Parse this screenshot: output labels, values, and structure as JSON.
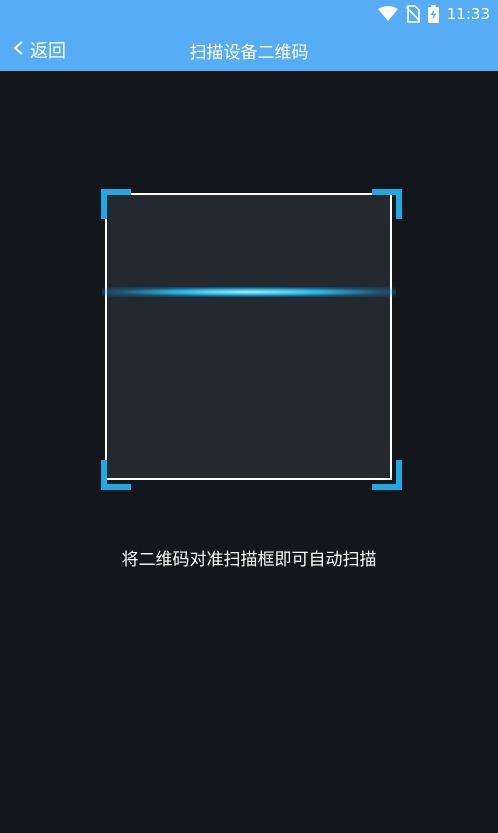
{
  "status_bar": {
    "time": "11:33",
    "icons": [
      "wifi-icon",
      "no-sim-icon",
      "battery-charging-icon"
    ]
  },
  "toolbar": {
    "back_label": "返回",
    "title": "扫描设备二维码"
  },
  "scanner": {
    "hint": "将二维码对准扫描框即可自动扫描",
    "frame_color": "#ffffff",
    "corner_color": "#20a8e3",
    "scan_line_color": "#28c8f5"
  },
  "colors": {
    "app_bar": "#56adf6",
    "background": "#13161b",
    "frame_fill": "#242930"
  }
}
